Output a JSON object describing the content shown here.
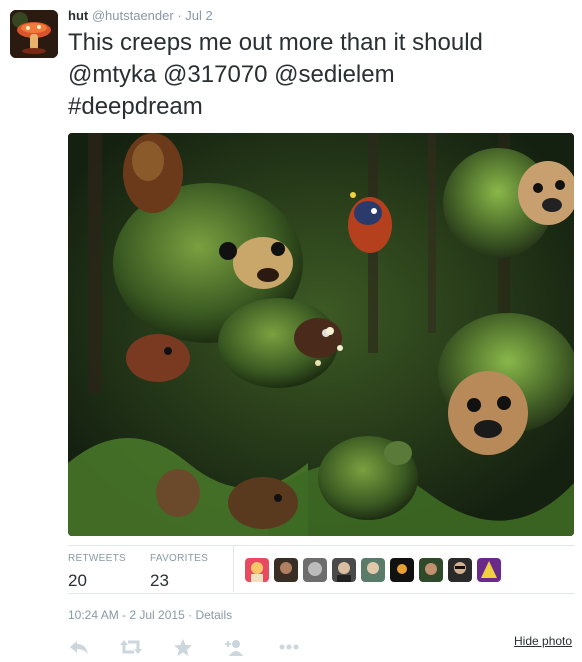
{
  "tweet": {
    "author_name": "hut",
    "author_handle": "@hutstaender",
    "separator": "·",
    "date": "Jul 2",
    "text_line_1": "This creeps me out more than it should",
    "mentions": [
      "@mtyka",
      "@317070",
      "@sedielem"
    ],
    "hashtag": "#deepdream"
  },
  "stats": {
    "retweets_label": "RETWEETS",
    "retweets_count": "20",
    "favorites_label": "FAVORITES",
    "favorites_count": "23"
  },
  "favoriters": [
    {
      "name": "favoriter-avatar-1",
      "bg": "#e84a5f"
    },
    {
      "name": "favoriter-avatar-2",
      "bg": "#3a2d24"
    },
    {
      "name": "favoriter-avatar-3",
      "bg": "#6d6d6d"
    },
    {
      "name": "favoriter-avatar-4",
      "bg": "#4a4a4a"
    },
    {
      "name": "favoriter-avatar-5",
      "bg": "#5a7a6a"
    },
    {
      "name": "favoriter-avatar-6",
      "bg": "#111111"
    },
    {
      "name": "favoriter-avatar-7",
      "bg": "#2f4a2a"
    },
    {
      "name": "favoriter-avatar-8",
      "bg": "#2a2a2a"
    },
    {
      "name": "favoriter-avatar-9",
      "bg": "#6a2a8a"
    }
  ],
  "timestamp": {
    "time_date": "10:24 AM - 2 Jul 2015",
    "separator": "·",
    "details_link": "Details"
  },
  "actions": {
    "icons": [
      "reply-icon",
      "retweet-icon",
      "favorite-icon",
      "follow-icon",
      "more-icon"
    ],
    "hide_photo": "Hide photo"
  },
  "colors": {
    "text": "#292f33",
    "muted": "#8899a6",
    "rule": "#e1e8ed",
    "icon": "#ccd6dd"
  }
}
